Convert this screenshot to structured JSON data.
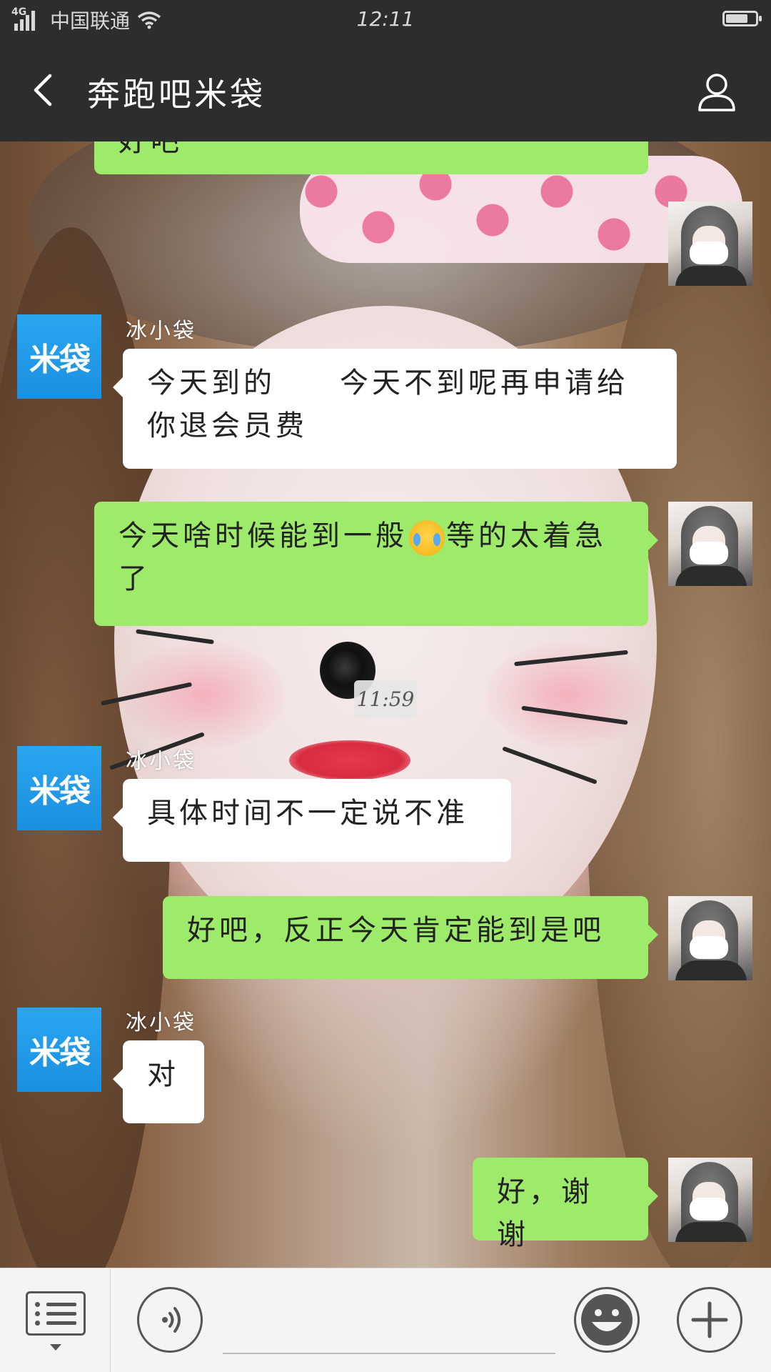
{
  "status_bar": {
    "network": "4G",
    "carrier": "中国联通",
    "time": "12:11",
    "battery_level": 0.75
  },
  "header": {
    "title": "奔跑吧米袋"
  },
  "messages": {
    "partial_top_text": "好吧",
    "m1": {
      "sender": "冰小袋",
      "avatar_text": "米袋",
      "text": "今天到的　　今天不到呢再申请给你退会员费"
    },
    "m2": {
      "text_before": "今天啥时候能到一般",
      "text_after": "等的太着急了"
    },
    "timestamp": "11:59",
    "m3": {
      "sender": "冰小袋",
      "avatar_text": "米袋",
      "text": "具体时间不一定说不准"
    },
    "m4": {
      "text": "好吧，反正今天肯定能到是吧"
    },
    "m5": {
      "sender": "冰小袋",
      "avatar_text": "米袋",
      "text": "对"
    },
    "m6": {
      "text": "好，谢谢"
    }
  },
  "colors": {
    "bar": "#2d2d2d",
    "bubble_sent": "#9eea6a",
    "bubble_received": "#ffffff",
    "avatar_brand": "#1b8fe0"
  },
  "icons": {
    "back": "chevron-left-icon",
    "profile": "person-icon",
    "menu": "list-menu-icon",
    "voice": "voice-icon",
    "emoji": "smiley-icon",
    "add": "plus-icon"
  }
}
